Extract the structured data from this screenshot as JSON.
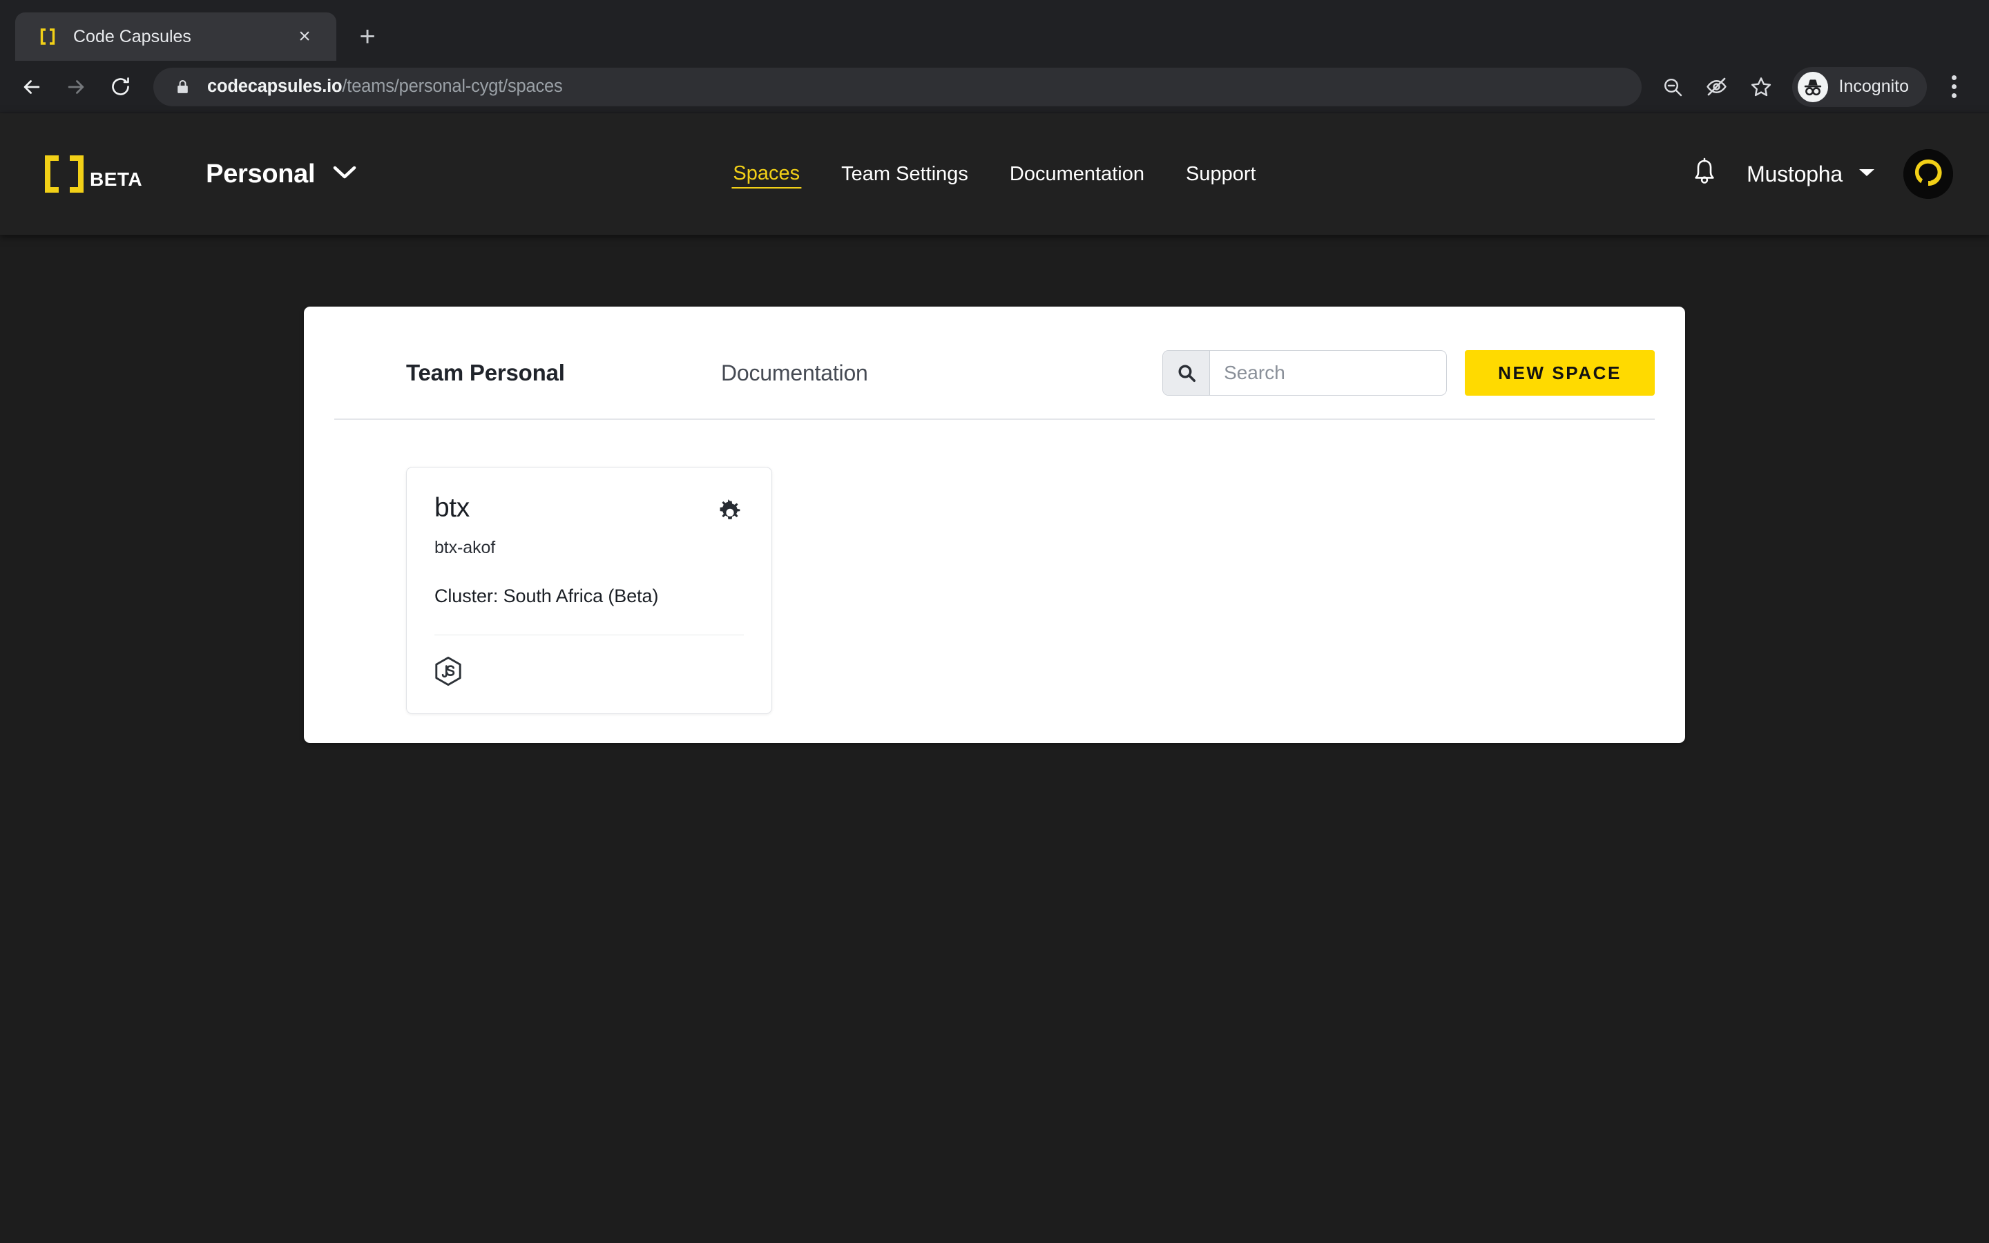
{
  "browser": {
    "tab": {
      "title": "Code Capsules",
      "favicon_icon": "brackets-logo-icon",
      "close_icon": "close-icon",
      "close_glyph": "×"
    },
    "new_tab_glyph": "+",
    "nav": {
      "back_icon": "arrow-left-icon",
      "forward_icon": "arrow-right-icon",
      "reload_icon": "reload-icon"
    },
    "omnibox": {
      "lock_icon": "lock-icon",
      "url_domain": "codecapsules.io",
      "url_path": "/teams/personal-cygt/spaces",
      "full_url": "codecapsules.io/teams/personal-cygt/spaces"
    },
    "actions": {
      "zoom_out_icon": "zoom-out-icon",
      "eye_slash_icon": "eye-slash-icon",
      "bookmark_icon": "star-icon",
      "menu_icon": "kebab-menu-icon"
    },
    "profile": {
      "label": "Incognito",
      "icon": "incognito-icon"
    }
  },
  "header": {
    "brand": {
      "logo_icon": "code-capsules-brackets-icon",
      "beta_label": "BETA",
      "logo_color": "#f2d017"
    },
    "team_switcher": {
      "label": "Personal",
      "chevron_icon": "chevron-down-icon"
    },
    "nav_links": [
      {
        "label": "Spaces",
        "active": true
      },
      {
        "label": "Team Settings",
        "active": false
      },
      {
        "label": "Documentation",
        "active": false
      },
      {
        "label": "Support",
        "active": false
      }
    ],
    "notifications_icon": "bell-icon",
    "user": {
      "name": "Mustopha",
      "chevron_icon": "chevron-down-icon",
      "avatar_icon": "user-avatar-icon"
    },
    "accent_color": "#f2d017",
    "background_color": "#212121"
  },
  "main": {
    "team_title": "Team Personal",
    "documentation_link": "Documentation",
    "search": {
      "placeholder": "Search",
      "value": "",
      "icon": "search-icon"
    },
    "new_space_button": {
      "label": "NEW SPACE",
      "color": "#ffda00"
    },
    "spaces": [
      {
        "name": "btx",
        "slug": "btx-akof",
        "cluster": "Cluster: South Africa (Beta)",
        "settings_icon": "gear-icon",
        "tech_icon": "nodejs-icon"
      }
    ]
  }
}
